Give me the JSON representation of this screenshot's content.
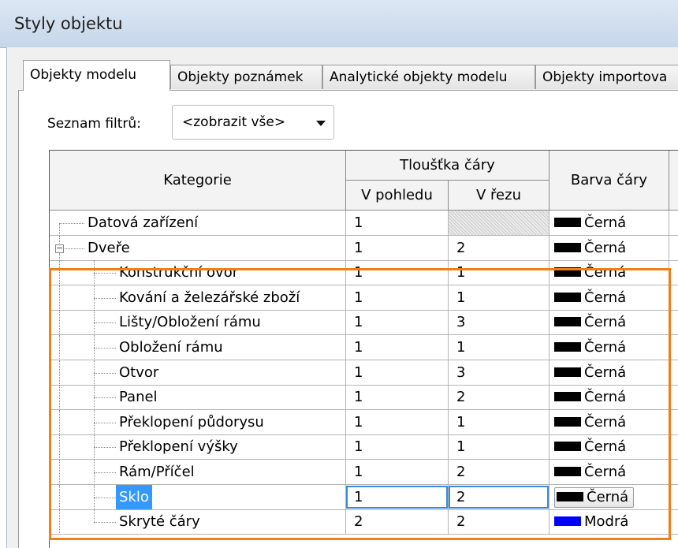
{
  "window": {
    "title": "Styly objektu"
  },
  "tabs": [
    {
      "label": "Objekty modelu",
      "active": true
    },
    {
      "label": "Objekty poznámek",
      "active": false
    },
    {
      "label": "Analytické objekty modelu",
      "active": false
    },
    {
      "label": "Objekty importova",
      "active": false
    }
  ],
  "filter": {
    "label": "Seznam filtrů:",
    "value": "<zobrazit vše>"
  },
  "table": {
    "headers": {
      "category": "Kategorie",
      "line_weight": "Tloušťka čáry",
      "projection": "V pohledu",
      "cut": "V řezu",
      "line_color": "Barva čáry"
    },
    "rows": [
      {
        "name": "Datová zařízení",
        "projection": "1",
        "cut": "",
        "color": "Černá",
        "level": 0
      },
      {
        "name": "Dveře",
        "projection": "1",
        "cut": "2",
        "color": "Černá",
        "level": 0,
        "expanded": true
      },
      {
        "name": "Konstrukční ovor",
        "projection": "1",
        "cut": "1",
        "color": "Černá",
        "level": 1
      },
      {
        "name": "Kování a železářské zboží",
        "projection": "1",
        "cut": "1",
        "color": "Černá",
        "level": 1
      },
      {
        "name": "Lišty/Obložení rámu",
        "projection": "1",
        "cut": "3",
        "color": "Černá",
        "level": 1
      },
      {
        "name": "Obložení rámu",
        "projection": "1",
        "cut": "1",
        "color": "Černá",
        "level": 1
      },
      {
        "name": "Otvor",
        "projection": "1",
        "cut": "3",
        "color": "Černá",
        "level": 1
      },
      {
        "name": "Panel",
        "projection": "1",
        "cut": "2",
        "color": "Černá",
        "level": 1
      },
      {
        "name": "Překlopení půdorysu",
        "projection": "1",
        "cut": "1",
        "color": "Černá",
        "level": 1
      },
      {
        "name": "Překlopení výšky",
        "projection": "1",
        "cut": "1",
        "color": "Černá",
        "level": 1
      },
      {
        "name": "Rám/Příčel",
        "projection": "1",
        "cut": "2",
        "color": "Černá",
        "level": 1
      },
      {
        "name": "Sklo",
        "projection": "1",
        "cut": "2",
        "color": "Černá",
        "level": 1,
        "selected": true
      },
      {
        "name": "Skryté čáry",
        "projection": "2",
        "cut": "2",
        "color": "Modrá",
        "level": 1
      }
    ]
  },
  "colors": {
    "highlight_border": "#f07f1a",
    "selection": "#3399ff",
    "black_swatch": "#000000",
    "blue_swatch": "#0000ff"
  }
}
